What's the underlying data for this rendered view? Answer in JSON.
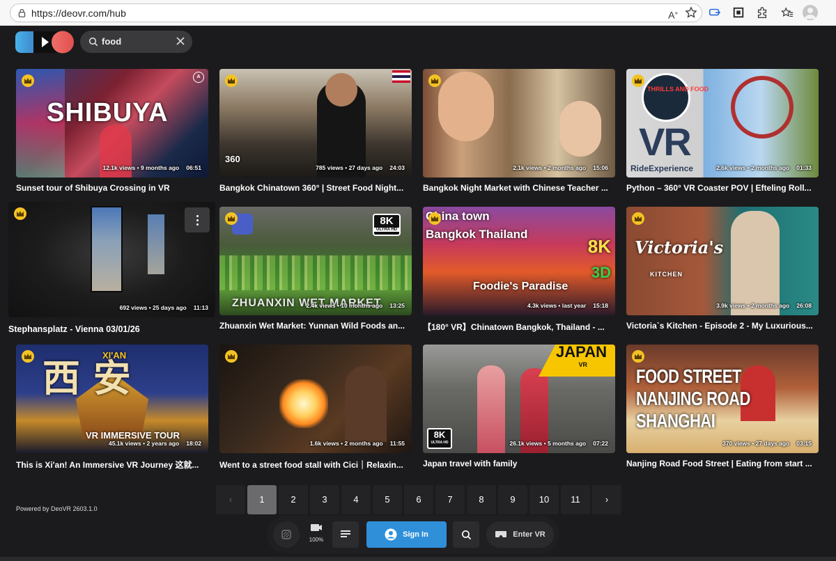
{
  "browser": {
    "url": "https://deovr.com/hub",
    "icons": [
      "lock-icon",
      "read-aloud-icon",
      "favorite-star-icon",
      "cast-icon",
      "screenshot-icon",
      "extensions-icon",
      "favorites-icon",
      "profile-icon"
    ]
  },
  "header": {
    "search_value": "food"
  },
  "videos": [
    {
      "title": "Sunset tour of Shibuya Crossing in VR",
      "views": "12.1k views",
      "age": "9 months ago",
      "duration": "06:51",
      "overlay": "SHIBUYA"
    },
    {
      "title": "Bangkok Chinatown 360° | Street Food Night...",
      "views": "785 views",
      "age": "27 days ago",
      "duration": "24:03",
      "overlay": "360"
    },
    {
      "title": "Bangkok Night Market with Chinese Teacher ...",
      "views": "2.1k views",
      "age": "2 months ago",
      "duration": "15:06",
      "overlay": ""
    },
    {
      "title": "Python – 360° VR Coaster POV | Efteling Roll...",
      "views": "2.6k views",
      "age": "2 months ago",
      "duration": "01:33",
      "overlay": "VR",
      "overlay2": "RideExperience",
      "overlay3": "THRILLS AND FOOD"
    },
    {
      "title": "Stephansplatz - Vienna   03/01/26",
      "views": "692 views",
      "age": "25 days ago",
      "duration": "11:13",
      "overlay": ""
    },
    {
      "title": "Zhuanxin Wet Market: Yunnan Wild Foods an...",
      "views": "2.4k views",
      "age": "10 months ago",
      "duration": "13:25",
      "overlay": "ZHUANXIN WET MARKET",
      "badge": "8K",
      "badge2": "ULTRA HD"
    },
    {
      "title": "【180° VR】Chinatown Bangkok, Thailand - ...",
      "views": "4.3k views",
      "age": "last year",
      "duration": "15:18",
      "overlay": "China town",
      "overlay2": "Bangkok Thailand",
      "overlay3": "Foodie's Paradise",
      "badge": "8K",
      "badge2": "3D"
    },
    {
      "title": "Victoria`s Kitchen - Episode 2 - My Luxurious...",
      "views": "3.9k views",
      "age": "2 months ago",
      "duration": "26:08",
      "overlay": "Victoria's",
      "overlay2": "KITCHEN"
    },
    {
      "title": "This is Xi'an! An Immersive VR Journey 这就...",
      "views": "45.1k views",
      "age": "2 years ago",
      "duration": "18:02",
      "overlay": "西   安",
      "overlay2": "VR IMMERSIVE TOUR",
      "overlay3": "XI'AN"
    },
    {
      "title": "Went to a street food stall with Cici｜Relaxin...",
      "views": "1.6k views",
      "age": "2 months ago",
      "duration": "11:55",
      "overlay": ""
    },
    {
      "title": "Japan travel with family",
      "views": "26.1k views",
      "age": "5 months ago",
      "duration": "07:22",
      "overlay": "JAPAN",
      "overlay2": "VR",
      "badge": "8K",
      "badge2": "ULTRA HD"
    },
    {
      "title": "Nanjing Road Food Street | Eating from start ...",
      "views": "370 views",
      "age": "27 days ago",
      "duration": "03:15",
      "overlay": "FOOD STREET",
      "overlay2": "NANJING ROAD",
      "overlay3": "SHANGHAI"
    }
  ],
  "pagination": {
    "prev": "‹",
    "next": "›",
    "pages": [
      "1",
      "2",
      "3",
      "4",
      "5",
      "6",
      "7",
      "8",
      "9",
      "10",
      "11"
    ],
    "current": "1"
  },
  "footer": {
    "powered_by": "Powered by DeoVR 2603.1.0"
  },
  "controls": {
    "zoom": "100%",
    "sign_in": "Sign In",
    "enter_vr": "Enter VR"
  },
  "colors": {
    "background": "#1b1b1d",
    "accent_blue": "#2f8fd8",
    "crown": "#f3c323"
  }
}
